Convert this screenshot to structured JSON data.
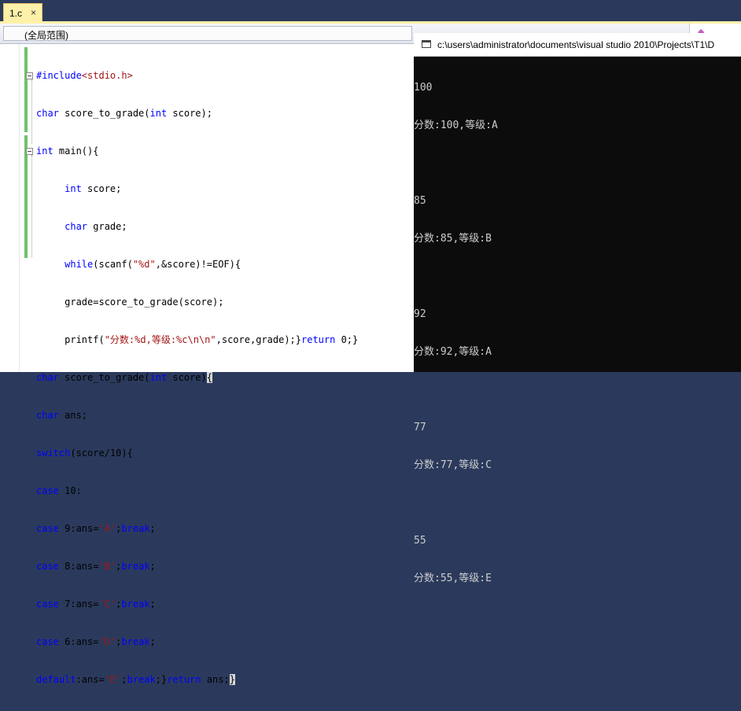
{
  "tab": {
    "label": "1.c",
    "close": "×"
  },
  "scope": {
    "label": "(全局范围)"
  },
  "editor": {
    "lines": [
      "#include<stdio.h>",
      "char score_to_grade(int score);",
      "int main(){",
      "    int score;",
      "    char grade;",
      "    while(scanf(\"%d\",&score)!=EOF){",
      "    grade=score_to_grade(score);",
      "    printf(\"分数:%d,等级:%c\\n\\n\",score,grade);}return 0;}",
      "char score_to_grade(int score){",
      "char ans;",
      "switch(score/10){",
      "case 10:",
      "case 9:ans='A';break;",
      "case 8:ans='B';break;",
      "case 7:ans='C';break;",
      "case 6:ans='D';break;",
      "default:ans='E';break;}return ans;}"
    ]
  },
  "console": {
    "title": "c:\\users\\administrator\\documents\\visual studio 2010\\Projects\\T1\\D",
    "lines": [
      "100",
      "分数:100,等级:A",
      "",
      "85",
      "分数:85,等级:B",
      "",
      "92",
      "分数:92,等级:A",
      "",
      "77",
      "分数:77,等级:C",
      "",
      "55",
      "分数:55,等级:E"
    ]
  },
  "colors": {
    "background": "#2b3a5c",
    "tab_active": "#fdf1a9",
    "keyword": "#0000ff",
    "string": "#a31515",
    "changed_bar": "#6fc26b",
    "console_bg": "#0c0c0c",
    "console_text": "#cccccc"
  },
  "icons": {
    "tab_close": "close-icon",
    "console": "console-window-icon",
    "fold": "collapse-box-icon"
  }
}
